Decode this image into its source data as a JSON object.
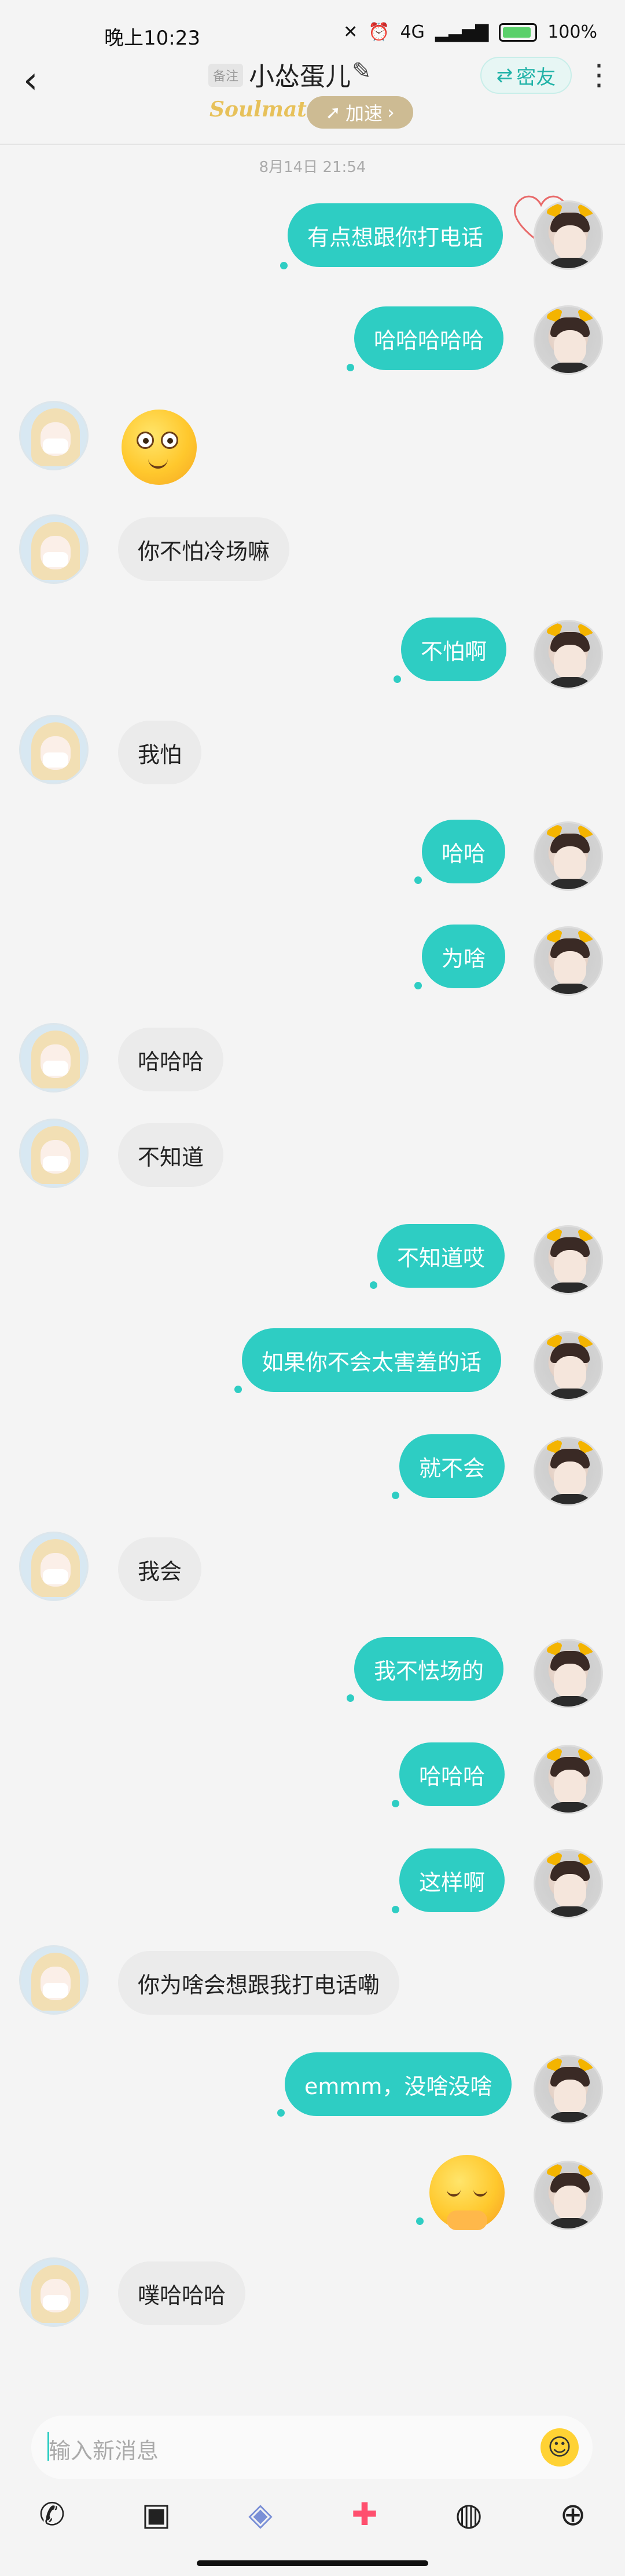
{
  "status": {
    "time": "晚上10:23",
    "network": "4G",
    "battery": "100%"
  },
  "header": {
    "remark_badge": "备注",
    "contact_name": "小怂蛋儿",
    "close_friend": "密友",
    "soulmate": "Soulmate",
    "boost": "加速"
  },
  "timestamp": "8月14日 21:54",
  "messages": [
    {
      "from": "me",
      "text": "有点想跟你打电话"
    },
    {
      "from": "me",
      "text": "哈哈哈哈哈"
    },
    {
      "from": "them",
      "emoji": "dizzy-face-emoji"
    },
    {
      "from": "them",
      "text": "你不怕冷场嘛"
    },
    {
      "from": "me",
      "text": "不怕啊"
    },
    {
      "from": "them",
      "text": "我怕"
    },
    {
      "from": "me",
      "text": "哈哈"
    },
    {
      "from": "me",
      "text": "为啥"
    },
    {
      "from": "them",
      "text": "哈哈哈"
    },
    {
      "from": "them",
      "text": "不知道"
    },
    {
      "from": "me",
      "text": "不知道哎"
    },
    {
      "from": "me",
      "text": "如果你不会太害羞的话"
    },
    {
      "from": "me",
      "text": "就不会"
    },
    {
      "from": "them",
      "text": "我会"
    },
    {
      "from": "me",
      "text": "我不怯场的"
    },
    {
      "from": "me",
      "text": "哈哈哈"
    },
    {
      "from": "me",
      "text": "这样啊"
    },
    {
      "from": "them",
      "text": "你为啥会想跟我打电话嘞"
    },
    {
      "from": "me",
      "text": "emmm，没啥没啥"
    },
    {
      "from": "me",
      "emoji": "sleepy-face-emoji"
    },
    {
      "from": "them",
      "text": "噗哈哈哈"
    }
  ],
  "input": {
    "placeholder": "输入新消息"
  },
  "toolbar": {
    "icons": [
      "phone-icon",
      "image-icon",
      "box-icon",
      "gift-icon",
      "voice-icon",
      "plus-icon"
    ]
  },
  "colors": {
    "accent": "#2ecdc3",
    "incoming": "#ebebeb",
    "background": "#f4f4f4"
  }
}
